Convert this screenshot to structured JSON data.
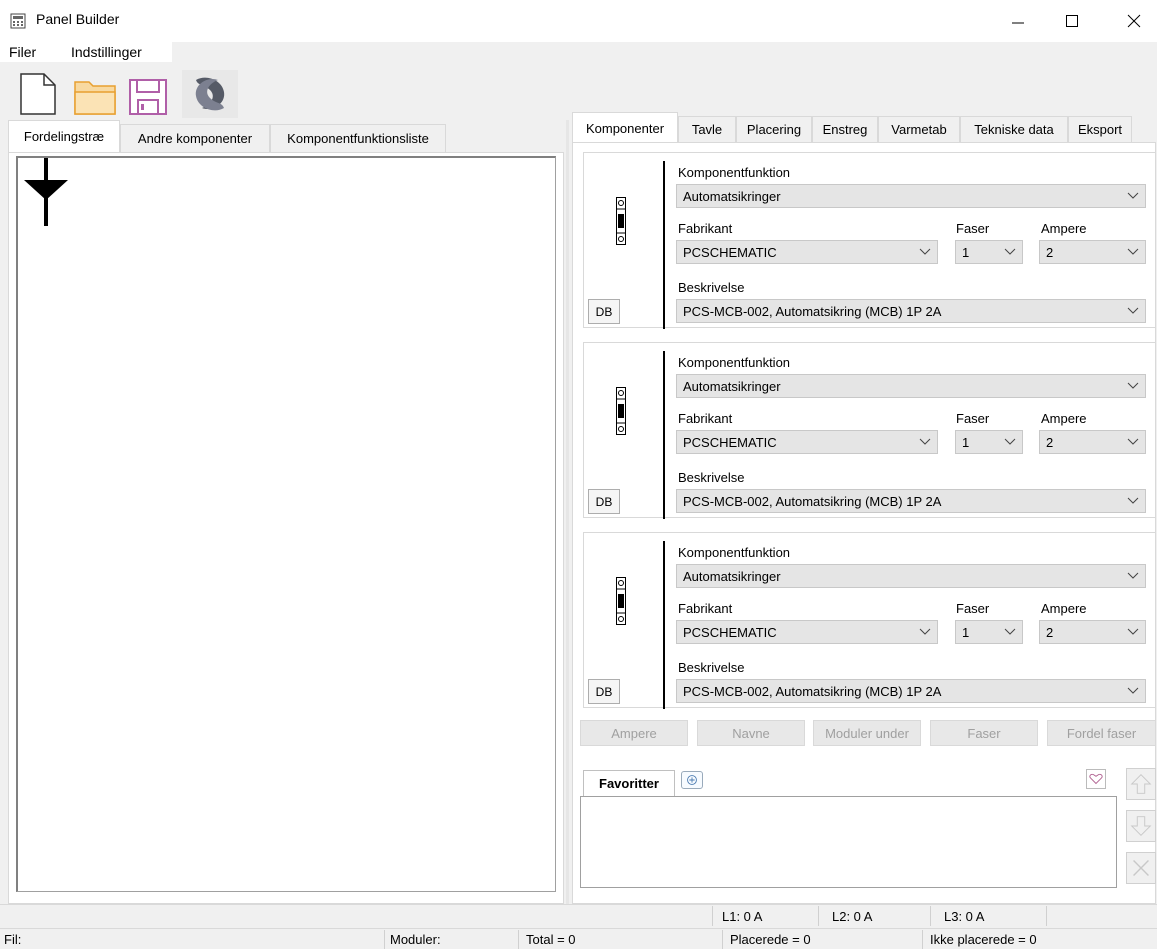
{
  "window": {
    "title": "Panel Builder"
  },
  "menu": {
    "file": "Filer",
    "settings": "Indstillinger"
  },
  "left_tabs": [
    "Fordelingstræ",
    "Andre komponenter",
    "Komponentfunktionsliste"
  ],
  "right_tabs": [
    "Komponenter",
    "Tavle",
    "Placering",
    "Enstreg",
    "Varmetab",
    "Tekniske data",
    "Eksport"
  ],
  "card_labels": {
    "function": "Komponentfunktion",
    "manufacturer": "Fabrikant",
    "phases": "Faser",
    "ampere": "Ampere",
    "description": "Beskrivelse",
    "db_button": "DB"
  },
  "cards": [
    {
      "function": "Automatsikringer",
      "manufacturer": "PCSCHEMATIC",
      "phases": "1",
      "ampere": "2",
      "description": "PCS-MCB-002, Automatsikring (MCB)  1P 2A"
    },
    {
      "function": "Automatsikringer",
      "manufacturer": "PCSCHEMATIC",
      "phases": "1",
      "ampere": "2",
      "description": "PCS-MCB-002, Automatsikring (MCB)  1P 2A"
    },
    {
      "function": "Automatsikringer",
      "manufacturer": "PCSCHEMATIC",
      "phases": "1",
      "ampere": "2",
      "description": "PCS-MCB-002, Automatsikring (MCB)  1P 2A"
    }
  ],
  "actions": [
    "Ampere",
    "Navne",
    "Moduler under",
    "Faser",
    "Fordel faser"
  ],
  "favorites": {
    "tab": "Favoritter"
  },
  "status": {
    "l1": "L1: 0 A",
    "l2": "L2: 0 A",
    "l3": "L3: 0 A",
    "file": "Fil:",
    "modules": "Moduler:",
    "total": "Total = 0",
    "placed": "Placerede = 0",
    "not_placed": "Ikke placerede = 0"
  },
  "colors": {
    "accent_orange": "#f5a623",
    "save_purple": "#b05fa8",
    "logo_gray": "#555a66"
  }
}
